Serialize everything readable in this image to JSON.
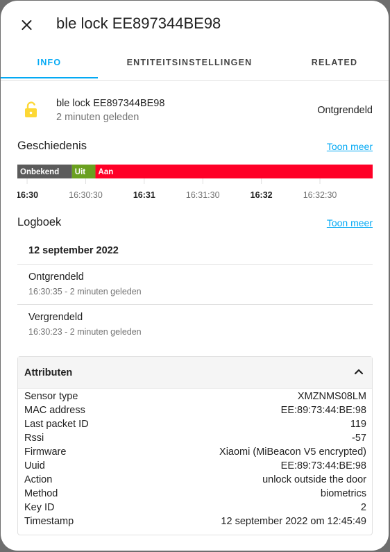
{
  "dialog": {
    "title": "ble lock EE897344BE98"
  },
  "tabs": [
    {
      "label": "INFO",
      "active": true
    },
    {
      "label": "ENTITEITSINSTELLINGEN",
      "active": false
    },
    {
      "label": "RELATED",
      "active": false
    }
  ],
  "entity": {
    "name": "ble lock EE897344BE98",
    "last_changed": "2 minuten geleden",
    "state": "Ontgrendeld",
    "icon": "lock-open-icon"
  },
  "history": {
    "title": "Geschiedenis",
    "more_link": "Toon meer",
    "segments": [
      {
        "label": "Onbekend",
        "color": "#5b5b5b",
        "start": "16:29:55",
        "end": "16:30:23"
      },
      {
        "label": "Uit",
        "color": "#6aa01f",
        "start": "16:30:23",
        "end": "16:30:35"
      },
      {
        "label": "Aan",
        "color": "#ff0027",
        "start": "16:30:35",
        "end": "16:32:57"
      }
    ],
    "ticks": [
      {
        "label": "16:30",
        "bold": true
      },
      {
        "label": "16:30:30",
        "bold": false
      },
      {
        "label": "16:31",
        "bold": true
      },
      {
        "label": "16:31:30",
        "bold": false
      },
      {
        "label": "16:32",
        "bold": true
      },
      {
        "label": "16:32:30",
        "bold": false
      }
    ]
  },
  "logbook": {
    "title": "Logboek",
    "more_link": "Toon meer",
    "date": "12 september 2022",
    "entries": [
      {
        "state": "Ontgrendeld",
        "time": "16:30:35 - 2 minuten geleden"
      },
      {
        "state": "Vergrendeld",
        "time": "16:30:23 - 2 minuten geleden"
      }
    ]
  },
  "attributes": {
    "title": "Attributen",
    "rows": [
      {
        "key": "Sensor type",
        "value": "XMZNMS08LM"
      },
      {
        "key": "MAC address",
        "value": "EE:89:73:44:BE:98"
      },
      {
        "key": "Last packet ID",
        "value": "119"
      },
      {
        "key": "Rssi",
        "value": "-57"
      },
      {
        "key": "Firmware",
        "value": "Xiaomi (MiBeacon V5 encrypted)"
      },
      {
        "key": "Uuid",
        "value": "EE:89:73:44:BE:98"
      },
      {
        "key": "Action",
        "value": "unlock outside the door"
      },
      {
        "key": "Method",
        "value": "biometrics"
      },
      {
        "key": "Key ID",
        "value": "2"
      },
      {
        "key": "Timestamp",
        "value": "12 september 2022 om 12:45:49"
      }
    ]
  },
  "colors": {
    "accent": "#03a9f4",
    "lock_icon": "#fdd835"
  }
}
